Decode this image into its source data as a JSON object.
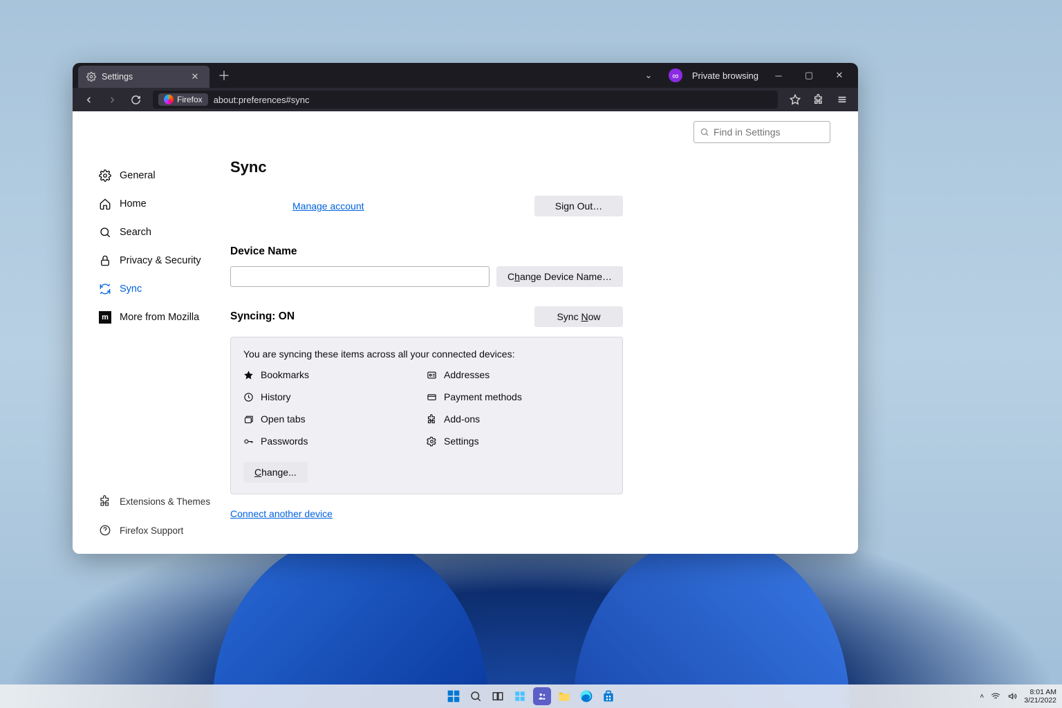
{
  "window": {
    "tab_title": "Settings",
    "private_browsing": "Private browsing",
    "url_chip": "Firefox",
    "url": "about:preferences#sync"
  },
  "search": {
    "placeholder": "Find in Settings"
  },
  "sidebar": {
    "items": [
      {
        "label": "General"
      },
      {
        "label": "Home"
      },
      {
        "label": "Search"
      },
      {
        "label": "Privacy & Security"
      },
      {
        "label": "Sync"
      },
      {
        "label": "More from Mozilla"
      }
    ],
    "bottom": [
      {
        "label": "Extensions & Themes"
      },
      {
        "label": "Firefox Support"
      }
    ]
  },
  "main": {
    "title": "Sync",
    "manage_account": "Manage account",
    "sign_out": "Sign Out…",
    "device_name_title": "Device Name",
    "device_name_value": "",
    "change_device": "Change Device Name…",
    "syncing_status": "Syncing: ON",
    "sync_now": "Sync Now",
    "sync_desc": "You are syncing these items across all your connected devices:",
    "items": {
      "bookmarks": "Bookmarks",
      "history": "History",
      "opentabs": "Open tabs",
      "passwords": "Passwords",
      "addresses": "Addresses",
      "payment": "Payment methods",
      "addons": "Add-ons",
      "settings": "Settings"
    },
    "change_btn": "Change...",
    "connect_link": "Connect another device"
  },
  "taskbar": {
    "time": "8:01 AM",
    "date": "3/21/2022"
  }
}
